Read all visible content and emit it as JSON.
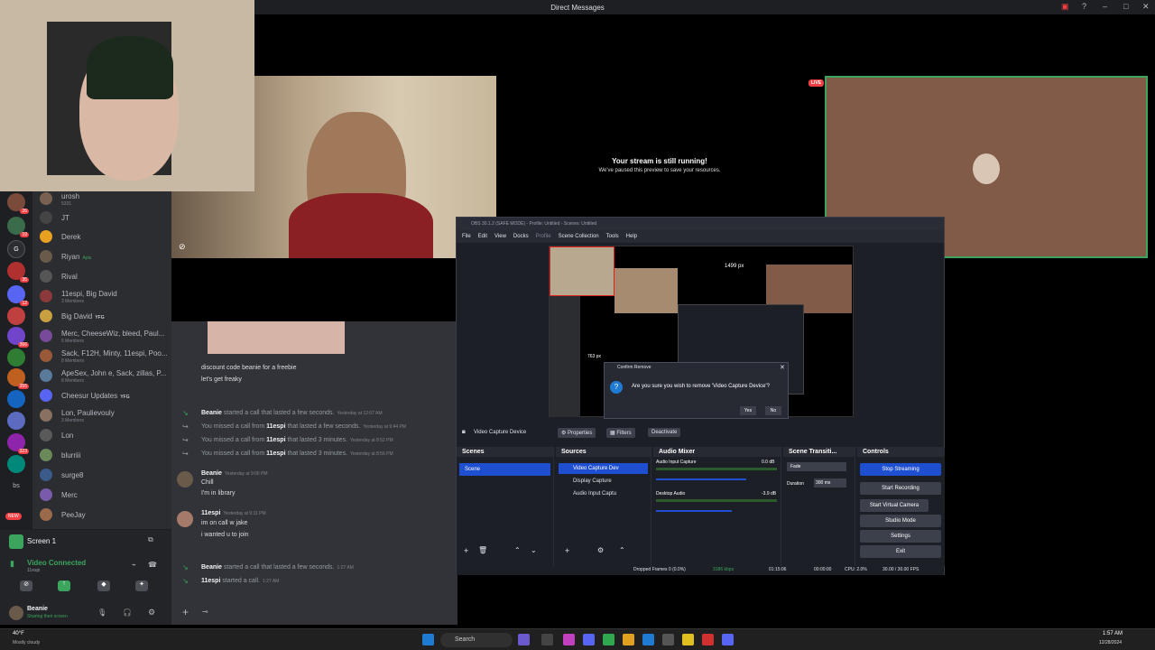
{
  "window": {
    "title": "Direct Messages"
  },
  "stream_preview": {
    "live_badge": "LIVE",
    "headline": "Your stream is still running!",
    "subline": "We've paused this preview to save your resources."
  },
  "dm_list": [
    {
      "name": "urosh",
      "sub": "5331"
    },
    {
      "name": "JT",
      "sub": ""
    },
    {
      "name": "Derek",
      "sub": ""
    },
    {
      "name": "Riyan",
      "sub": "Apis"
    },
    {
      "name": "Rival",
      "sub": ""
    },
    {
      "name": "11espi, Big David",
      "sub": "3 Members"
    },
    {
      "name": "Big David",
      "sub": "YFG"
    },
    {
      "name": "Merc, CheeseWiz, bleed, Paul...",
      "sub": "5 Members"
    },
    {
      "name": "Sack, F12H, Minty, 11espi, Poo...",
      "sub": "8 Members"
    },
    {
      "name": "ApeSex, John e, Sack, zillas, P...",
      "sub": "8 Members"
    },
    {
      "name": "Cheesur Updates",
      "sub": "YFG"
    },
    {
      "name": "Lon, Paulievouly",
      "sub": "3 Members"
    },
    {
      "name": "Lon",
      "sub": ""
    },
    {
      "name": "blurriii",
      "sub": ""
    },
    {
      "name": "surge8",
      "sub": ""
    },
    {
      "name": "Merc",
      "sub": ""
    },
    {
      "name": "PeeJay",
      "sub": ""
    }
  ],
  "server_badges": [
    "26",
    "19",
    "35",
    "12",
    "366",
    "355",
    "323",
    "NEW"
  ],
  "voice": {
    "screen_label": "Screen 1",
    "status": "Video Connected",
    "status_sub": "11espi",
    "user_name": "Beanie",
    "user_status": "Sharing their screen"
  },
  "chat": {
    "msg_top_1": "discount code beanie for a freebie",
    "msg_top_2": "let's get freaky",
    "sys1_name": "Beanie",
    "sys1_text": " started a call that lasted a few seconds.",
    "sys1_ts": "Yesterday at 12:07 AM",
    "sys2_pre": "You missed a call from ",
    "sys2_name": "11espi",
    "sys2_text": " that lasted a few seconds.",
    "sys2_ts": "Yesterday at 9:44 PM",
    "sys3_pre": "You missed a call from ",
    "sys3_name": "11espi",
    "sys3_text": " that lasted 3 minutes.",
    "sys3_ts": "Yesterday at 8:52 PM",
    "sys4_pre": "You missed a call from ",
    "sys4_name": "11espi",
    "sys4_text": " that lasted 3 minutes.",
    "sys4_ts": "Yesterday at 8:56 PM",
    "m1_author": "Beanie",
    "m1_ts": "Yesterday at 9:06 PM",
    "m1_l1": "Chill",
    "m1_l2": "I'm in library",
    "m2_author": "11espi",
    "m2_ts": "Yesterday at 9:11 PM",
    "m2_l1": "im on call w jake",
    "m2_l2": "i wanted u to join",
    "sys5_name": "Beanie",
    "sys5_text": " started a call that lasted a few seconds.",
    "sys5_ts": "1:27 AM",
    "sys6_name": "11espi",
    "sys6_text": " started a call.",
    "sys6_ts": "1:27 AM"
  },
  "obs": {
    "title": "OBS 30.1.2 (SAFE MODE) - Profile: Untitled - Scenes: Untitled",
    "menu": [
      "File",
      "Edit",
      "View",
      "Docks",
      "Profile",
      "Scene Collection",
      "Tools",
      "Help"
    ],
    "preview_label_px": "1499 px",
    "preview_label_px2": "763 px",
    "source_bar": {
      "source": "Video Capture Device",
      "properties": "Properties",
      "filters": "Filters",
      "deactivate": "Deactivate"
    },
    "scenes": {
      "header": "Scenes",
      "items": [
        "Scene"
      ]
    },
    "sources": {
      "header": "Sources",
      "items": [
        "Video Capture Dev",
        "Display Capture",
        "Audio Input Captu"
      ]
    },
    "mixer": {
      "header": "Audio Mixer",
      "tracks": [
        {
          "name": "Audio Input Capture",
          "db": "0.0 dB"
        },
        {
          "name": "Desktop Audio",
          "db": "-3.9 dB"
        }
      ],
      "scale": "-60 -55 -50 -45 -40 -35 -30 -25 -20 -15 -10 -5 0"
    },
    "transitions": {
      "header": "Scene Transiti...",
      "type": "Fade",
      "duration_label": "Duration",
      "duration": "300 ms"
    },
    "controls": {
      "header": "Controls",
      "stop_streaming": "Stop Streaming",
      "start_recording": "Start Recording",
      "start_virtual": "Start Virtual Camera",
      "studio": "Studio Mode",
      "settings": "Settings",
      "exit": "Exit"
    },
    "status": {
      "dropped": "Dropped Frames 0 (0.0%)",
      "kbps": "3186 kbps",
      "stream_time": "01:15:06",
      "rec_time": "00:00:00",
      "cpu": "CPU: 2.0%",
      "fps": "30.00 / 30.00 FPS"
    },
    "dialog": {
      "title": "Confirm Remove",
      "question": "Are you sure you wish to remove 'Video Capture Device'?",
      "yes": "Yes",
      "no": "No"
    }
  },
  "taskbar": {
    "weather_temp": "40°F",
    "weather_desc": "Mostly cloudy",
    "search": "Search",
    "time": "1:57 AM",
    "date": "12/28/2024"
  },
  "colors": {
    "discord_bg": "#313338",
    "obs_accent": "#1f4fd1",
    "live": "#f23f43",
    "green": "#3ba55d"
  }
}
